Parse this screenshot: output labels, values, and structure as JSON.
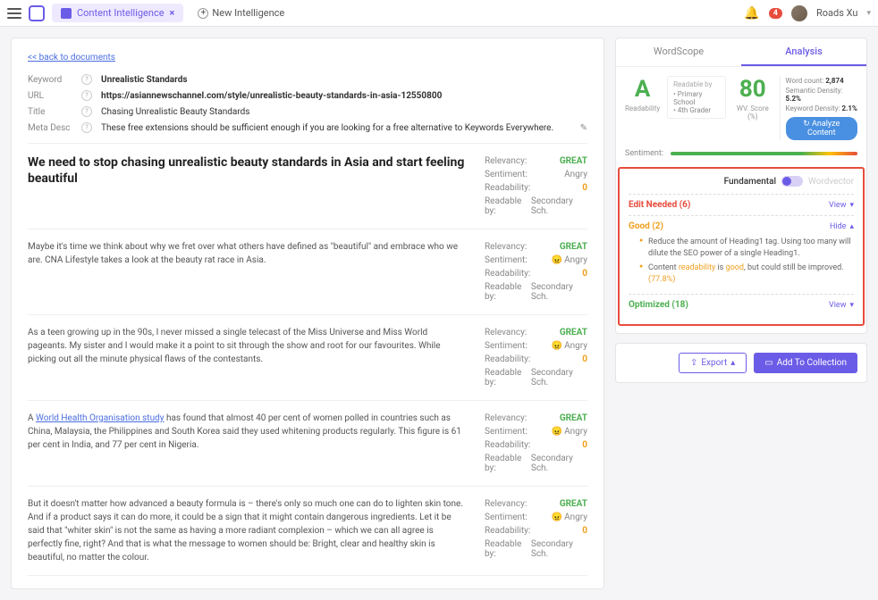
{
  "topbar": {
    "tab_label": "Content Intelligence",
    "new_label": "New Intelligence",
    "badge": "4",
    "user": "Roads Xu"
  },
  "meta": {
    "back": "<< back to documents",
    "rows": [
      {
        "label": "Keyword",
        "value": "Unrealistic Standards",
        "bold": true
      },
      {
        "label": "URL",
        "value": "https://asiannewschannel.com/style/unrealistic-beauty-standards-in-asia-12550800",
        "bold": true
      },
      {
        "label": "Title",
        "value": "Chasing Unrealistic Beauty Standards",
        "bold": false
      },
      {
        "label": "Meta Desc",
        "value": "These free extensions should be sufficient enough if you are looking for a free alternative to Keywords Everywhere.",
        "bold": false,
        "editable": true
      }
    ]
  },
  "sections": [
    {
      "title": "We need to stop chasing unrealistic beauty standards in Asia and start feeling beautiful",
      "body": "",
      "metrics": {
        "relevancy": "GREAT",
        "sentiment": "Angry",
        "sentiment_emoji": false,
        "readability": "0",
        "readable_by": "Secondary Sch."
      }
    },
    {
      "body": "Maybe it's time we think about why we fret over what others have defined as \"beautiful\" and embrace who we are. CNA Lifestyle takes a look at the beauty rat race in Asia.",
      "metrics": {
        "relevancy": "GREAT",
        "sentiment": "Angry",
        "sentiment_emoji": true,
        "readability": "0",
        "readable_by": "Secondary Sch."
      }
    },
    {
      "body": "As a teen growing up in the 90s, I never missed a single telecast of the Miss Universe and Miss World pageants. My sister and I would make it a point to sit through the show and root for our favourites. While picking out all the minute physical flaws of the contestants.",
      "metrics": {
        "relevancy": "GREAT",
        "sentiment": "Angry",
        "sentiment_emoji": true,
        "readability": "0",
        "readable_by": "Secondary Sch."
      }
    },
    {
      "body_html": "A <a href='#'>World Health Organisation study</a> has found that almost 40 per cent of women polled in countries such as China, Malaysia, the Philippines and South Korea said they used whitening products regularly. This figure is 61 per cent in India, and 77 per cent in Nigeria.",
      "metrics": {
        "relevancy": "GREAT",
        "sentiment": "Angry",
        "sentiment_emoji": true,
        "readability": "0",
        "readable_by": "Secondary Sch."
      }
    },
    {
      "body": "But it doesn't matter how advanced a beauty formula is – there's only so much one can do to lighten skin tone. And if a product says it can do more, it could be a sign that it might contain dangerous ingredients. Let it be said that \"whiter skin\" is not the same as having a more radiant complexion – which we can all agree is perfectly fine, right? And that is what the message to women should be: Bright, clear and healthy skin is beautiful, no matter the colour.",
      "metrics": {
        "relevancy": "GREAT",
        "sentiment": "Angry",
        "sentiment_emoji": true,
        "readability": "0",
        "readable_by": "Secondary Sch."
      }
    }
  ],
  "analysis": {
    "tabs": [
      "WordScope",
      "Analysis"
    ],
    "active_tab": 1,
    "grade": "A",
    "grade_label": "Readability",
    "readable_by": {
      "hdr": "Readable by",
      "items": [
        "• Primary  School",
        "• 4th Grader"
      ]
    },
    "wv_score": "80",
    "wv_label": "WV. Score (%)",
    "stats": [
      {
        "k": "Word count:",
        "v": "2,874"
      },
      {
        "k": "Semantic Density:",
        "v": "5.2%"
      },
      {
        "k": "Keyword Density:",
        "v": "2.1%"
      }
    ],
    "analyze_btn": "Analyze Content",
    "sentiment_label": "Sentiment:",
    "fundamental": "Fundamental",
    "wordvector": "Wordvector",
    "groups": [
      {
        "cls": "red",
        "label": "Edit Needed (6)",
        "action": "View",
        "chev": "▾",
        "open": false
      },
      {
        "cls": "orange",
        "label": "Good (2)",
        "action": "Hide",
        "chev": "▴",
        "open": true,
        "items": [
          {
            "text": "Reduce the amount of Heading1 tag. Using too many will dilute the SEO power of a single Heading1."
          },
          {
            "text": "Content <span class='hl-orange'>readability</span> is <span class='hl-orange'>good</span>, but could still be improved. <span class='hl-pct'>(77.8%)</span>"
          }
        ]
      },
      {
        "cls": "green",
        "label": "Optimized (18)",
        "action": "View",
        "chev": "▾",
        "open": false
      }
    ]
  },
  "actions": {
    "export": "Export",
    "add": "Add To Collection"
  }
}
